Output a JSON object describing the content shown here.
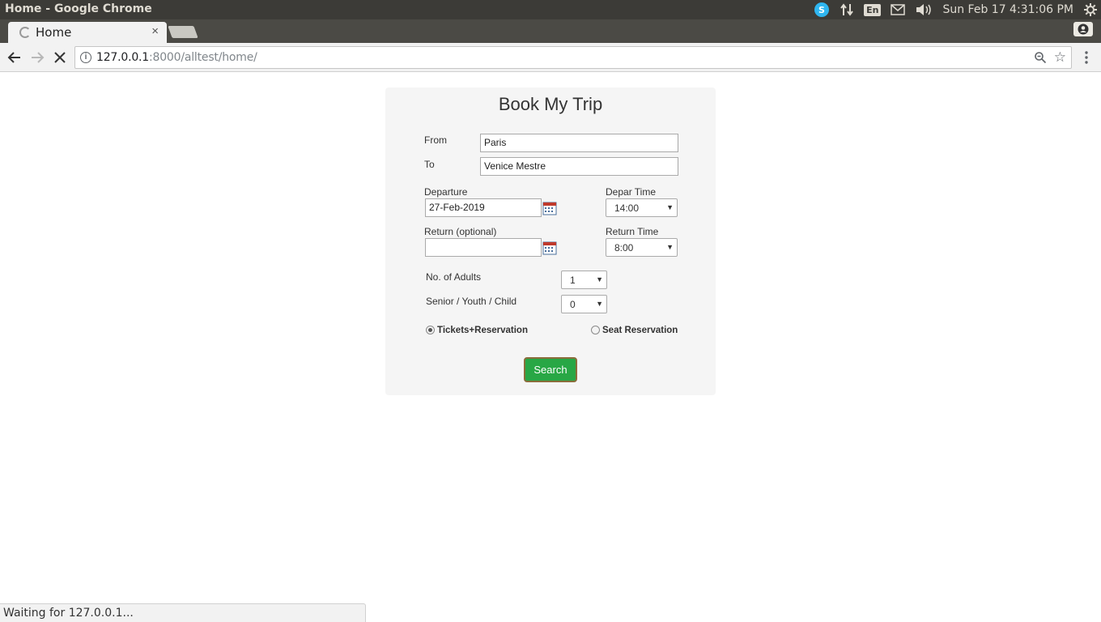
{
  "os_panel": {
    "window_title": "Home - Google Chrome",
    "keyboard_layout": "En",
    "clock": "Sun Feb 17  4:31:06 PM",
    "icons": [
      "skype-icon",
      "network-icon",
      "keyboard-layout-icon",
      "mail-icon",
      "volume-icon",
      "settings-icon"
    ]
  },
  "browser": {
    "tab_title": "Home",
    "tab_close": "×",
    "url_host": "127.0.0.1",
    "url_rest": ":8000/alltest/home/",
    "status_text": "Waiting for 127.0.0.1..."
  },
  "form": {
    "title": "Book My Trip",
    "from_label": "From",
    "from_value": "Paris",
    "to_label": "To",
    "to_value": "Venice Mestre",
    "departure_label": "Departure",
    "departure_value": "27-Feb-2019",
    "depar_time_label": "Depar Time",
    "depar_time_value": "14:00",
    "return_label": "Return (optional)",
    "return_value": "",
    "return_time_label": "Return Time",
    "return_time_value": "8:00",
    "adults_label": "No. of Adults",
    "adults_value": "1",
    "senior_label": "Senior / Youth / Child",
    "senior_value": "0",
    "option_tickets_label": "Tickets+Reservation",
    "option_seat_label": "Seat Reservation",
    "search_label": "Search"
  },
  "colors": {
    "search_button": "#28a745",
    "card_background": "#f5f5f5",
    "os_panel": "#3c3b37"
  }
}
